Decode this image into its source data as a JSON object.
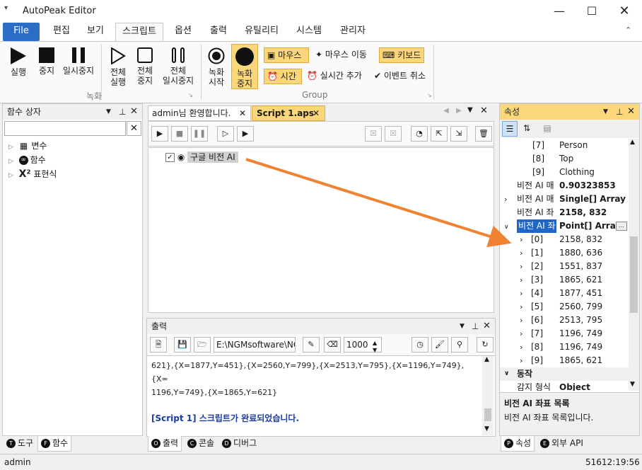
{
  "app": {
    "title": "AutoPeak Editor"
  },
  "menu": {
    "tabs": [
      "File",
      "편집",
      "보기",
      "스크립트",
      "옵션",
      "출력",
      "유틸리티",
      "시스템",
      "관리자"
    ]
  },
  "ribbon": {
    "run": "실행",
    "stop": "중지",
    "pause": "일시중지",
    "all_run": [
      "전체",
      "실행"
    ],
    "all_stop": [
      "전체",
      "중지"
    ],
    "all_pause": [
      "전체",
      "일시중지"
    ],
    "rec_start": [
      "녹화",
      "시작"
    ],
    "rec_stop": [
      "녹화",
      "중지"
    ],
    "group_rec": "녹화",
    "group_group": "Group",
    "mouse": "마우스",
    "mouse_move": "마우스 이동",
    "keyboard": "키보드",
    "time": "시간",
    "realtime_add": "실시간 추가",
    "event_cancel": "이벤트 취소"
  },
  "left_panel": {
    "title": "함수 상자",
    "items": [
      "변수",
      "함수",
      "표현식"
    ],
    "tabs": [
      "도구",
      "함수"
    ]
  },
  "editor": {
    "tabs": [
      "admin님 환영합니다.",
      "Script 1.aps"
    ],
    "node_label": "구글 비전 AI"
  },
  "output": {
    "title": "출력",
    "path": "E:\\NGMsoftware\\NG",
    "count": "1000",
    "lines": [
      "621},{X=1877,Y=451},{X=2560,Y=799},{X=2513,Y=795},{X=1196,Y=749},{X=",
      "1196,Y=749},{X=1865,Y=621}"
    ],
    "done": "[Script 1] 스크립트가 완료되었습니다.",
    "tabs": [
      "출력",
      "콘솔",
      "디버그"
    ]
  },
  "properties": {
    "title": "속성",
    "rows": [
      {
        "k": "[7]",
        "v": "Person",
        "indent": true
      },
      {
        "k": "[8]",
        "v": "Top",
        "indent": true
      },
      {
        "k": "[9]",
        "v": "Clothing",
        "indent": true
      },
      {
        "k": "비전 AI 매",
        "v": "0.90323853",
        "bold": true
      },
      {
        "k": "비전 AI 매",
        "v": "Single[] Array",
        "bold": true,
        "exp": true
      },
      {
        "k": "비전 AI 좌",
        "v": "2158, 832",
        "bold": true
      },
      {
        "k": "비전 AI 좌",
        "v": "Point[] Array",
        "bold": true,
        "sel": true,
        "open": true
      },
      {
        "k": "[0]",
        "v": "2158, 832",
        "child": true
      },
      {
        "k": "[1]",
        "v": "1880, 636",
        "child": true
      },
      {
        "k": "[2]",
        "v": "1551, 837",
        "child": true
      },
      {
        "k": "[3]",
        "v": "1865, 621",
        "child": true
      },
      {
        "k": "[4]",
        "v": "1877, 451",
        "child": true
      },
      {
        "k": "[5]",
        "v": "2560, 799",
        "child": true
      },
      {
        "k": "[6]",
        "v": "2513, 795",
        "child": true
      },
      {
        "k": "[7]",
        "v": "1196, 749",
        "child": true
      },
      {
        "k": "[8]",
        "v": "1196, 749",
        "child": true
      },
      {
        "k": "[9]",
        "v": "1865, 621",
        "child": true
      }
    ],
    "category": "동작",
    "last_k": "감지 형식",
    "last_v": "Object",
    "desc_title": "비전 AI 좌표 목록",
    "desc_text": "비전 AI 좌표 목록입니다.",
    "tabs": [
      "속성",
      "외부 API"
    ]
  },
  "status": {
    "user": "admin",
    "time": "51612:19:56"
  }
}
